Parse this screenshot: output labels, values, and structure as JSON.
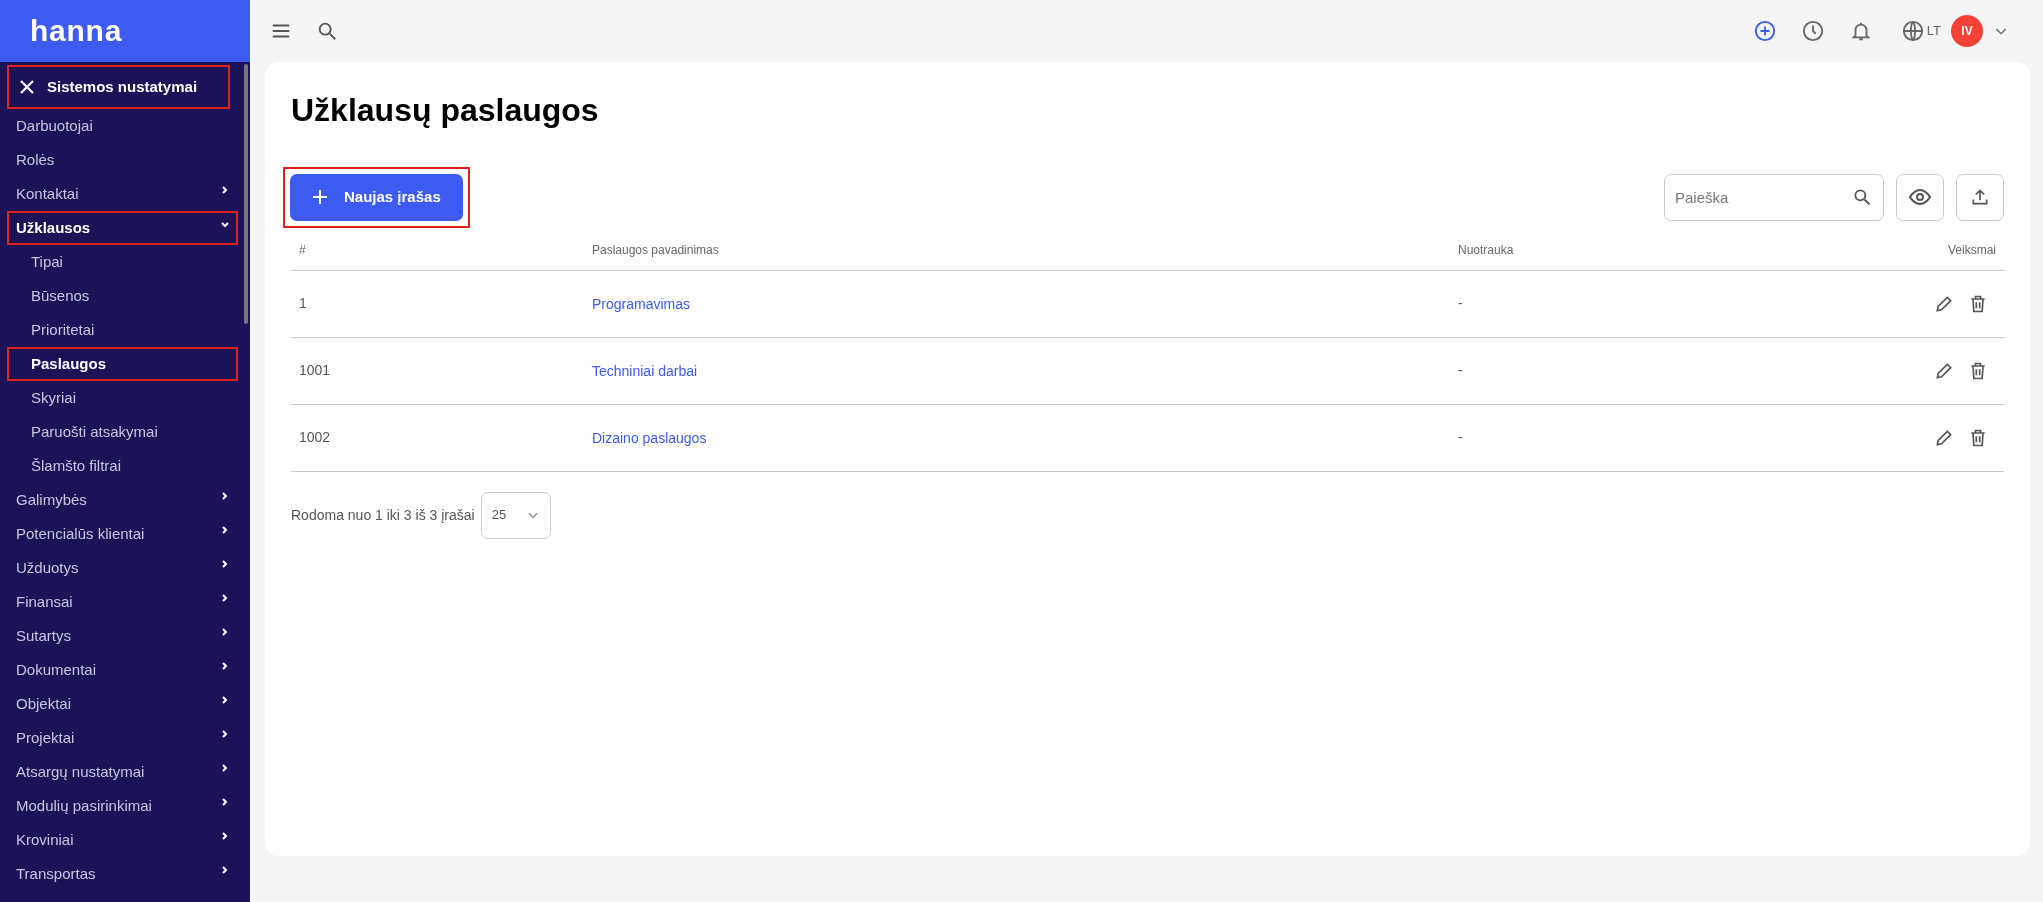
{
  "logo": "hanna",
  "sidebar": {
    "header": {
      "label": "Sistemos nustatymai",
      "highlighted": true
    },
    "items": [
      {
        "label": "Darbuotojai",
        "kind": "link",
        "selected": false,
        "highlighted": false
      },
      {
        "label": "Rolės",
        "kind": "link",
        "selected": false,
        "highlighted": false
      },
      {
        "label": "Kontaktai",
        "kind": "group",
        "expanded": false,
        "highlighted": false
      },
      {
        "label": "Užklausos",
        "kind": "group",
        "expanded": true,
        "highlighted": true,
        "children": [
          {
            "label": "Tipai",
            "kind": "link",
            "selected": false,
            "highlighted": false
          },
          {
            "label": "Būsenos",
            "kind": "link",
            "selected": false,
            "highlighted": false
          },
          {
            "label": "Prioritetai",
            "kind": "link",
            "selected": false,
            "highlighted": false
          },
          {
            "label": "Paslaugos",
            "kind": "link",
            "selected": true,
            "highlighted": true
          },
          {
            "label": "Skyriai",
            "kind": "link",
            "selected": false,
            "highlighted": false
          },
          {
            "label": "Paruošti atsakymai",
            "kind": "link",
            "selected": false,
            "highlighted": false
          },
          {
            "label": "Šlamšto filtrai",
            "kind": "link",
            "selected": false,
            "highlighted": false
          }
        ]
      },
      {
        "label": "Galimybės",
        "kind": "group",
        "expanded": false,
        "highlighted": false
      },
      {
        "label": "Potencialūs klientai",
        "kind": "group",
        "expanded": false,
        "highlighted": false
      },
      {
        "label": "Užduotys",
        "kind": "group",
        "expanded": false,
        "highlighted": false
      },
      {
        "label": "Finansai",
        "kind": "group",
        "expanded": false,
        "highlighted": false
      },
      {
        "label": "Sutartys",
        "kind": "group",
        "expanded": false,
        "highlighted": false
      },
      {
        "label": "Dokumentai",
        "kind": "group",
        "expanded": false,
        "highlighted": false
      },
      {
        "label": "Objektai",
        "kind": "group",
        "expanded": false,
        "highlighted": false
      },
      {
        "label": "Projektai",
        "kind": "group",
        "expanded": false,
        "highlighted": false
      },
      {
        "label": "Atsargų nustatymai",
        "kind": "group",
        "expanded": false,
        "highlighted": false
      },
      {
        "label": "Modulių pasirinkimai",
        "kind": "group",
        "expanded": false,
        "highlighted": false
      },
      {
        "label": "Kroviniai",
        "kind": "group",
        "expanded": false,
        "highlighted": false
      },
      {
        "label": "Transportas",
        "kind": "group",
        "expanded": false,
        "highlighted": false
      }
    ]
  },
  "topbar": {
    "language": "LT",
    "avatar_initials": "IV"
  },
  "page": {
    "title": "Užklausų paslaugos",
    "new_button": {
      "label": "Naujas įrašas",
      "highlighted": true
    },
    "search": {
      "placeholder": "Paieška"
    },
    "table": {
      "columns": [
        "#",
        "Paslaugos pavadinimas",
        "Nuotrauka",
        "Veiksmai"
      ],
      "rows": [
        {
          "id": "1",
          "name": "Programavimas",
          "photo": "-"
        },
        {
          "id": "1001",
          "name": "Techniniai darbai",
          "photo": "-"
        },
        {
          "id": "1002",
          "name": "Dizaino paslaugos",
          "photo": "-"
        }
      ]
    },
    "pagination": {
      "summary": "Rodoma nuo 1 iki 3 iš 3 įrašai",
      "page_size": "25"
    }
  }
}
